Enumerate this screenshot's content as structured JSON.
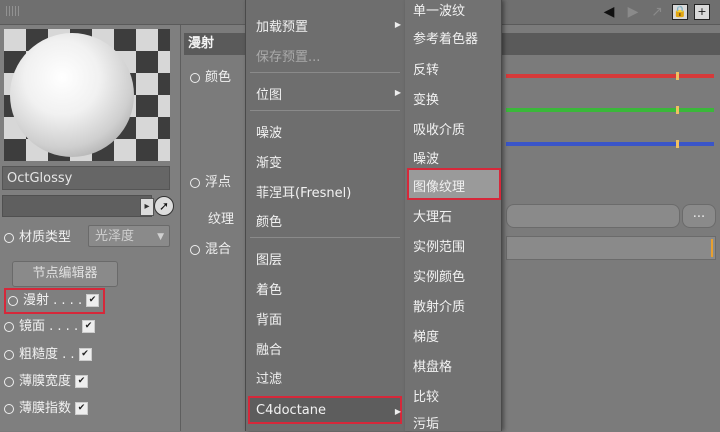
{
  "material": {
    "name": "OctGlossy",
    "type_label": "材质类型",
    "type_value": "光泽度",
    "node_editor_label": "节点编辑器",
    "channels": [
      {
        "label": "漫射",
        "dots": " . . . .",
        "checked": true
      },
      {
        "label": "镜面",
        "dots": " . . . .",
        "checked": true
      },
      {
        "label": "粗糙度",
        "dots": " . .",
        "checked": true
      },
      {
        "label": "薄膜宽度",
        "dots": "",
        "checked": true
      },
      {
        "label": "薄膜指数",
        "dots": "",
        "checked": true
      }
    ]
  },
  "attributes": {
    "section_title": "漫射",
    "color_label": "颜色",
    "float_label": "浮点",
    "texture_label": "纹理",
    "mix_label": "混合",
    "ellipsis": "...",
    "slider_colors": [
      "#d63a3a",
      "#3ab83a",
      "#3a55c8"
    ]
  },
  "menu1": {
    "items": [
      {
        "label": "加载预置",
        "submenu": true,
        "disabled": false
      },
      {
        "label": "保存预置...",
        "submenu": false,
        "disabled": true
      },
      {
        "label": "位图",
        "submenu": true,
        "disabled": false
      },
      {
        "label": "噪波",
        "submenu": false,
        "disabled": false
      },
      {
        "label": "渐变",
        "submenu": false,
        "disabled": false
      },
      {
        "label": "菲涅耳(Fresnel)",
        "submenu": false,
        "disabled": false
      },
      {
        "label": "颜色",
        "submenu": false,
        "disabled": false
      },
      {
        "label": "图层",
        "submenu": false,
        "disabled": false
      },
      {
        "label": "着色",
        "submenu": false,
        "disabled": false
      },
      {
        "label": "背面",
        "submenu": false,
        "disabled": false
      },
      {
        "label": "融合",
        "submenu": false,
        "disabled": false
      },
      {
        "label": "过滤",
        "submenu": false,
        "disabled": false
      },
      {
        "label": "C4doctane",
        "submenu": true,
        "disabled": false
      }
    ]
  },
  "menu2": {
    "items": [
      "单一波纹",
      "参考着色器",
      "反转",
      "变换",
      "吸收介质",
      "噪波",
      "图像纹理",
      "大理石",
      "实例范围",
      "实例颜色",
      "散射介质",
      "梯度",
      "棋盘格",
      "比较",
      "污垢"
    ]
  },
  "colors": {
    "highlight": "#d6283a"
  }
}
